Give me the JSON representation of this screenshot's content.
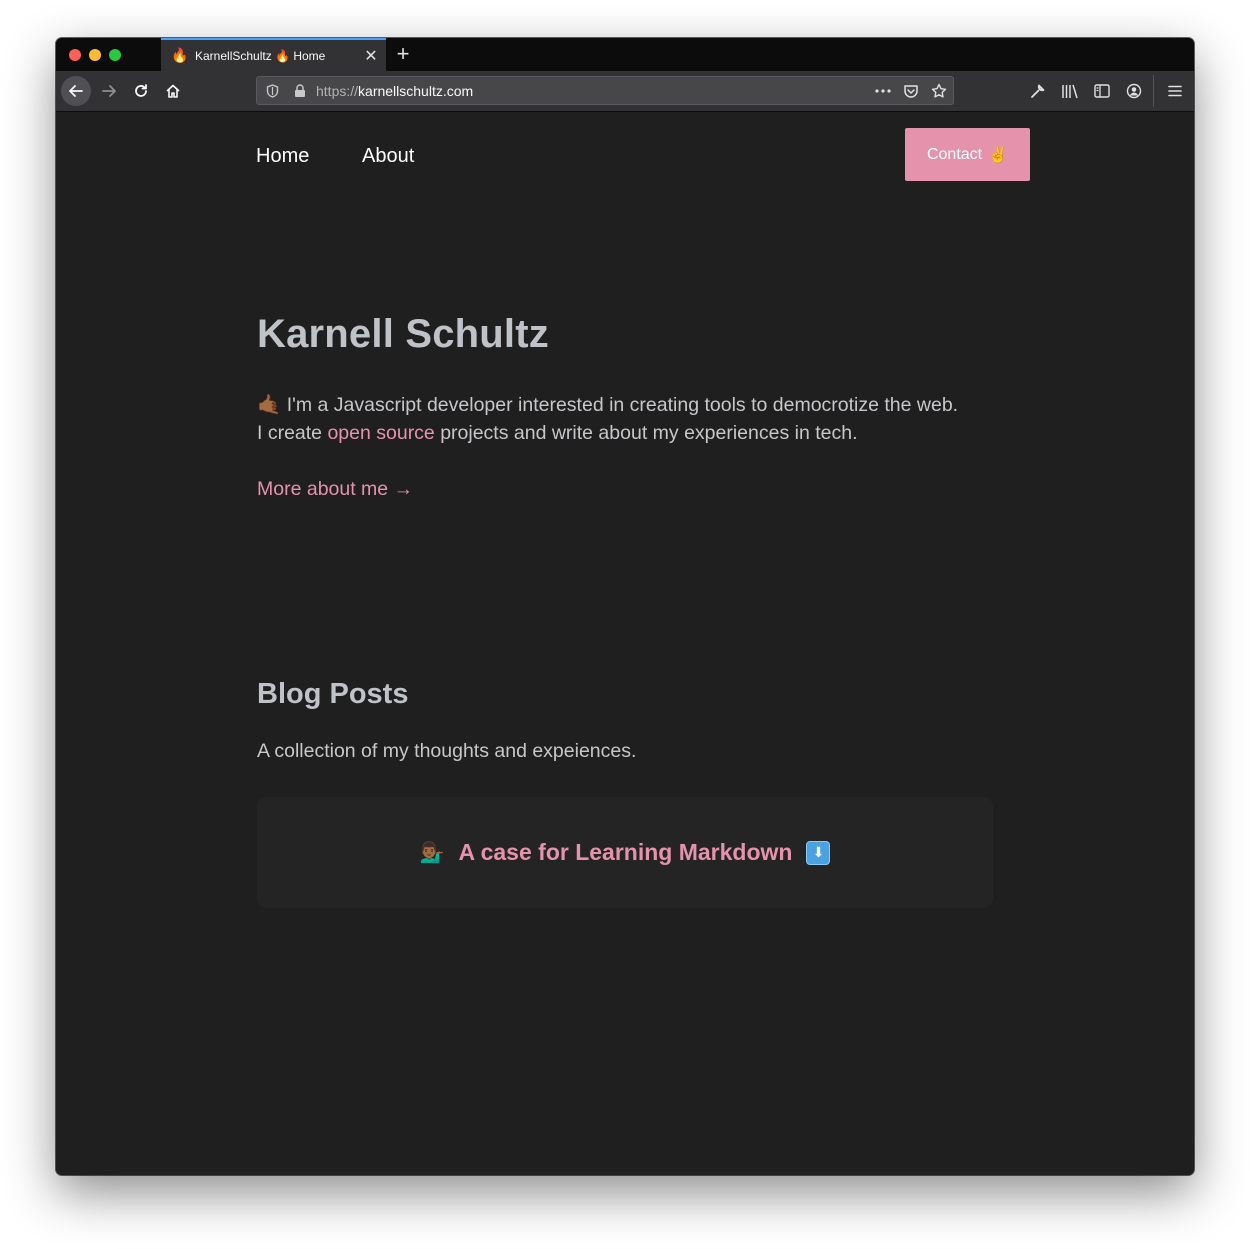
{
  "browser": {
    "tab": {
      "favicon": "🔥",
      "title": "KarnellSchultz 🔥 Home",
      "close_label": "✕"
    },
    "new_tab_label": "+",
    "url": {
      "protocol": "https://",
      "host": "karnellschultz.com"
    },
    "icons": [
      "back-arrow-icon",
      "forward-arrow-icon",
      "reload-icon",
      "home-icon",
      "shield-icon",
      "lock-icon",
      "more-dots-icon",
      "pocket-icon",
      "star-icon",
      "wrench-icon",
      "library-icon",
      "sidebar-icon",
      "account-icon",
      "hamburger-menu-icon"
    ]
  },
  "site": {
    "nav": {
      "home": "Home",
      "about": "About"
    },
    "contact": {
      "label": "Contact",
      "emoji": "✌️"
    },
    "hero": {
      "title": "Karnell Schultz",
      "emoji": "🤙🏾",
      "line1": "I'm a Javascript developer interested in creating tools to democrotize the web.",
      "line2_pre": "I create ",
      "line2_link": "open source",
      "line2_post": " projects and write about my experiences in tech."
    },
    "more_link": "More about me →",
    "blog": {
      "title": "Blog Posts",
      "subtitle": "A collection of my thoughts and expeiences.",
      "posts": [
        {
          "emoji": "💁🏾‍♂️",
          "title": "A case for Learning Markdown",
          "badge": "⬇"
        }
      ]
    },
    "colors": {
      "accent": "#e593ad",
      "background": "#1f1f1f",
      "heading": "#bfc2c7",
      "text": "#c7c7cb"
    }
  }
}
